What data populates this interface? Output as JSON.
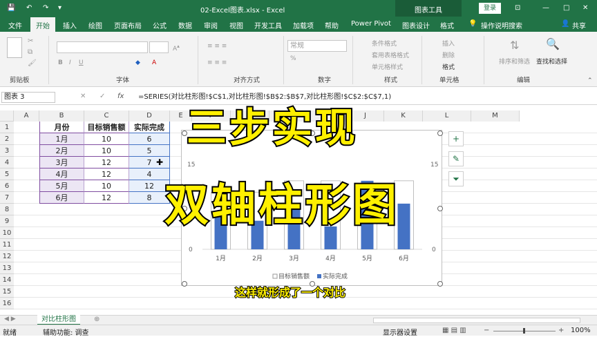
{
  "titlebar": {
    "save_icon": "save-icon",
    "undo_icon": "undo-icon",
    "redo_icon": "redo-icon",
    "customize_icon": "customize-icon",
    "doc_title": "02-Excel图表.xlsx  -  Excel",
    "tool_label": "图表工具",
    "login_label": "登录",
    "minimize": "—",
    "maximize": "□",
    "close": "✕"
  },
  "tabs": [
    {
      "label": "文件"
    },
    {
      "label": "开始"
    },
    {
      "label": "插入"
    },
    {
      "label": "绘图"
    },
    {
      "label": "页面布局"
    },
    {
      "label": "公式"
    },
    {
      "label": "数据"
    },
    {
      "label": "审阅"
    },
    {
      "label": "视图"
    },
    {
      "label": "开发工具"
    },
    {
      "label": "加载项"
    },
    {
      "label": "帮助"
    },
    {
      "label": "Power Pivot"
    },
    {
      "label": "图表设计"
    },
    {
      "label": "格式"
    }
  ],
  "tell_me": "操作说明搜索",
  "share": "共享",
  "ribbon": {
    "groups": [
      "剪贴板",
      "字体",
      "对齐方式",
      "数字",
      "样式",
      "单元格",
      "编辑"
    ],
    "number_format": "常规",
    "styles": [
      "条件格式",
      "套用表格格式",
      "单元格样式"
    ],
    "cells": [
      "插入",
      "删除",
      "格式"
    ],
    "editing": [
      "排序和筛选",
      "查找和选择"
    ]
  },
  "formula_bar": {
    "name_box": "图表 3",
    "formula": "=SERIES(对比柱形图!$C$1,对比柱形图!$B$2:$B$7,对比柱形图!$C$2:$C$7,1)",
    "fx": "fx"
  },
  "columns": [
    "A",
    "B",
    "C",
    "D",
    "E",
    "F",
    "G",
    "H",
    "I",
    "J",
    "K",
    "L",
    "M"
  ],
  "rows": [
    "1",
    "2",
    "3",
    "4",
    "5",
    "6",
    "7",
    "8",
    "9",
    "10",
    "11",
    "12",
    "13",
    "14",
    "15",
    "16"
  ],
  "table": {
    "headers": [
      "月份",
      "目标销售额",
      "实际完成"
    ],
    "rows": [
      [
        "1月",
        "10",
        "6"
      ],
      [
        "2月",
        "10",
        "5"
      ],
      [
        "3月",
        "12",
        "7"
      ],
      [
        "4月",
        "12",
        "4"
      ],
      [
        "5月",
        "10",
        "12"
      ],
      [
        "6月",
        "12",
        "8"
      ]
    ]
  },
  "chart_data": {
    "type": "bar",
    "title": "",
    "categories": [
      "1月",
      "2月",
      "3月",
      "4月",
      "5月",
      "6月"
    ],
    "series": [
      {
        "name": "目标销售额",
        "values": [
          10,
          10,
          12,
          12,
          10,
          12
        ],
        "axis": "primary"
      },
      {
        "name": "实际完成",
        "values": [
          6,
          5,
          7,
          4,
          12,
          8
        ],
        "axis": "secondary"
      }
    ],
    "ylim": [
      0,
      15
    ],
    "y2lim": [
      0,
      15
    ],
    "yticks": [
      "0",
      "15"
    ],
    "y2ticks": [
      "0",
      "15"
    ],
    "legend": "bottom",
    "colors": {
      "target": "#ffffff",
      "actual": "#4472c4"
    }
  },
  "overlay": {
    "line1": "三步实现",
    "line2": "双轴柱形图",
    "subtitle": "这样就形成了一个对比"
  },
  "side_buttons": [
    "plus-icon",
    "brush-icon",
    "filter-icon"
  ],
  "sheet_tab": "对比柱形图",
  "status": {
    "ready": "就绪",
    "accessibility": "辅助功能: 调查",
    "display": "显示器设置",
    "zoom": "100%"
  }
}
